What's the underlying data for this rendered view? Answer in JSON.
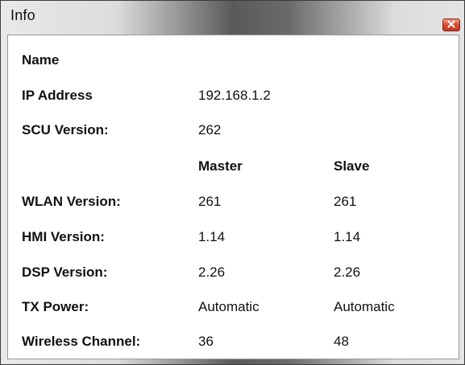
{
  "window": {
    "title": "Info"
  },
  "info": {
    "name_label": "Name",
    "ip_label": "IP Address",
    "ip_value": "192.168.1.2",
    "scu_label": "SCU Version:",
    "scu_value": "262",
    "master_header": "Master",
    "slave_header": "Slave",
    "rows": [
      {
        "label": "WLAN Version:",
        "master": "261",
        "slave": "261"
      },
      {
        "label": "HMI Version:",
        "master": "1.14",
        "slave": "1.14"
      },
      {
        "label": "DSP Version:",
        "master": "2.26",
        "slave": "2.26"
      },
      {
        "label": "TX Power:",
        "master": "Automatic",
        "slave": "Automatic"
      },
      {
        "label": "Wireless Channel:",
        "master": "36",
        "slave": "48"
      }
    ]
  },
  "icons": {
    "close": "close-icon"
  }
}
